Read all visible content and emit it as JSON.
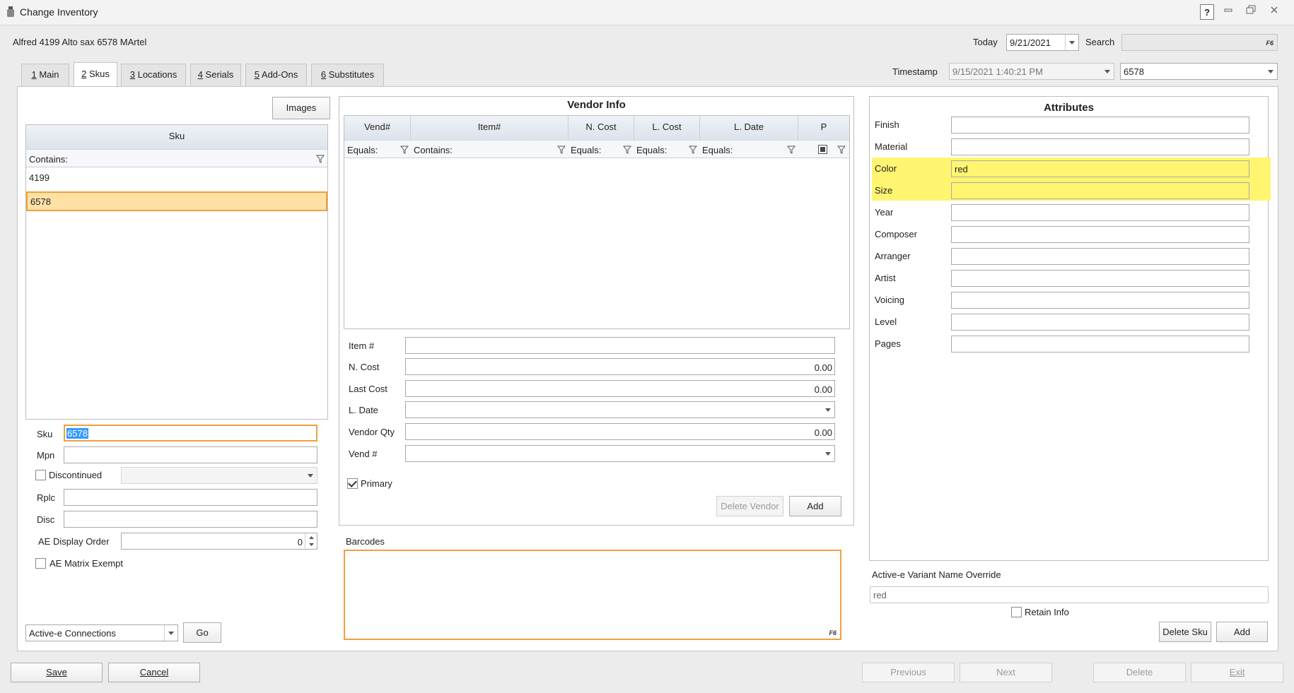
{
  "window": {
    "title": "Change Inventory",
    "help": "?"
  },
  "header": {
    "item_title": "Alfred 4199 Alto sax 6578 MArtel",
    "today_label": "Today",
    "today_value": "9/21/2021",
    "search_label": "Search",
    "search_value": "",
    "fx": "F6",
    "timestamp_label": "Timestamp",
    "timestamp_value": "9/15/2021 1:40:21 PM",
    "sku_select_value": "6578"
  },
  "tabs": [
    {
      "num": "1",
      "label": " Main"
    },
    {
      "num": "2",
      "label": " Skus"
    },
    {
      "num": "3",
      "label": " Locations"
    },
    {
      "num": "4",
      "label": " Serials"
    },
    {
      "num": "5",
      "label": " Add-Ons"
    },
    {
      "num": "6",
      "label": " Substitutes"
    }
  ],
  "sku_panel": {
    "images_button": "Images",
    "grid_header": "Sku",
    "filter_label": "Contains:",
    "rows": [
      "4199",
      "6578"
    ],
    "selected_row": "6578",
    "sku_label": "Sku",
    "sku_value": "6578",
    "mpn_label": "Mpn",
    "discontinued_label": "Discontinued",
    "rplc_label": "Rplc",
    "disc_label": "Disc",
    "ae_display_order_label": "AE Display Order",
    "ae_display_order_value": "0",
    "ae_matrix_exempt_label": "AE Matrix Exempt",
    "connections_value": "Active-e Connections",
    "go_button": "Go"
  },
  "vendor_info": {
    "title": "Vendor Info",
    "columns": [
      "Vend#",
      "Item#",
      "N. Cost",
      "L. Cost",
      "L. Date",
      "P"
    ],
    "filters": [
      "Equals:",
      "Contains:",
      "Equals:",
      "Equals:",
      "Equals:"
    ],
    "item_label": "Item #",
    "ncost_label": "N. Cost",
    "ncost_value": "0.00",
    "lastcost_label": "Last Cost",
    "lastcost_value": "0.00",
    "ldate_label": "L. Date",
    "vendorqty_label": "Vendor Qty",
    "vendorqty_value": "0.00",
    "vend_label": "Vend #",
    "primary_label": "Primary",
    "delete_vendor_button": "Delete Vendor",
    "add_button": "Add"
  },
  "barcodes": {
    "label": "Barcodes",
    "fx": "F6"
  },
  "attributes": {
    "title": "Attributes",
    "rows": [
      {
        "label": "Finish",
        "value": ""
      },
      {
        "label": "Material",
        "value": ""
      },
      {
        "label": "Color",
        "value": "red"
      },
      {
        "label": "Size",
        "value": ""
      },
      {
        "label": "Year",
        "value": ""
      },
      {
        "label": "Composer",
        "value": ""
      },
      {
        "label": "Arranger",
        "value": ""
      },
      {
        "label": "Artist",
        "value": ""
      },
      {
        "label": "Voicing",
        "value": ""
      },
      {
        "label": "Level",
        "value": ""
      },
      {
        "label": "Pages",
        "value": ""
      }
    ],
    "highlight_color": "#fff571",
    "variant_override_label": "Active-e Variant Name Override",
    "variant_override_value": "red",
    "retain_info_label": "Retain Info",
    "delete_sku_button": "Delete Sku",
    "add_button": "Add"
  },
  "footer": {
    "save": "Save",
    "cancel": "Cancel",
    "previous": "Previous",
    "next": "Next",
    "delete": "Delete",
    "exit": "Exit"
  },
  "colors": {
    "accent_orange": "#f0a040",
    "selected_row_bg": "#ffe1a6"
  }
}
